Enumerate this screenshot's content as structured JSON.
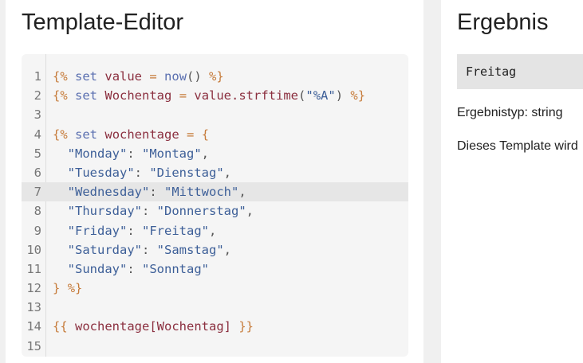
{
  "editor": {
    "title": "Template-Editor",
    "lines": [
      {
        "num": "1",
        "tokens": [
          {
            "t": "{%",
            "c": "delim"
          },
          {
            "t": " "
          },
          {
            "t": "set",
            "c": "kw"
          },
          {
            "t": " "
          },
          {
            "t": "value",
            "c": "var"
          },
          {
            "t": " = ",
            "c": "delim"
          },
          {
            "t": "now",
            "c": "kw"
          },
          {
            "t": "()",
            "c": "punc"
          },
          {
            "t": " "
          },
          {
            "t": "%}",
            "c": "delim"
          }
        ]
      },
      {
        "num": "2",
        "tokens": [
          {
            "t": "{%",
            "c": "delim"
          },
          {
            "t": " "
          },
          {
            "t": "set",
            "c": "kw"
          },
          {
            "t": " "
          },
          {
            "t": "Wochentag",
            "c": "var"
          },
          {
            "t": " = ",
            "c": "delim"
          },
          {
            "t": "value.strftime",
            "c": "var"
          },
          {
            "t": "(",
            "c": "punc"
          },
          {
            "t": "\"%A\"",
            "c": "str"
          },
          {
            "t": ")",
            "c": "punc"
          },
          {
            "t": " "
          },
          {
            "t": "%}",
            "c": "delim"
          }
        ]
      },
      {
        "num": "3",
        "tokens": []
      },
      {
        "num": "4",
        "tokens": [
          {
            "t": "{%",
            "c": "delim"
          },
          {
            "t": " "
          },
          {
            "t": "set",
            "c": "kw"
          },
          {
            "t": " "
          },
          {
            "t": "wochentage",
            "c": "var"
          },
          {
            "t": " = ",
            "c": "delim"
          },
          {
            "t": "{",
            "c": "delim"
          }
        ]
      },
      {
        "num": "5",
        "tokens": [
          {
            "t": "  "
          },
          {
            "t": "\"Monday\"",
            "c": "str"
          },
          {
            "t": ": ",
            "c": "punc"
          },
          {
            "t": "\"Montag\"",
            "c": "str"
          },
          {
            "t": ",",
            "c": "punc"
          }
        ]
      },
      {
        "num": "6",
        "tokens": [
          {
            "t": "  "
          },
          {
            "t": "\"Tuesday\"",
            "c": "str"
          },
          {
            "t": ": ",
            "c": "punc"
          },
          {
            "t": "\"Dienstag\"",
            "c": "str"
          },
          {
            "t": ",",
            "c": "punc"
          }
        ]
      },
      {
        "num": "7",
        "tokens": [
          {
            "t": "  "
          },
          {
            "t": "\"Wednesday\"",
            "c": "str"
          },
          {
            "t": ": ",
            "c": "punc"
          },
          {
            "t": "\"Mittwoch\"",
            "c": "str"
          },
          {
            "t": ",",
            "c": "punc"
          }
        ],
        "active": true
      },
      {
        "num": "8",
        "tokens": [
          {
            "t": "  "
          },
          {
            "t": "\"Thursday\"",
            "c": "str"
          },
          {
            "t": ": ",
            "c": "punc"
          },
          {
            "t": "\"Donnerstag\"",
            "c": "str"
          },
          {
            "t": ",",
            "c": "punc"
          }
        ]
      },
      {
        "num": "9",
        "tokens": [
          {
            "t": "  "
          },
          {
            "t": "\"Friday\"",
            "c": "str"
          },
          {
            "t": ": ",
            "c": "punc"
          },
          {
            "t": "\"Freitag\"",
            "c": "str"
          },
          {
            "t": ",",
            "c": "punc"
          }
        ]
      },
      {
        "num": "10",
        "tokens": [
          {
            "t": "  "
          },
          {
            "t": "\"Saturday\"",
            "c": "str"
          },
          {
            "t": ": ",
            "c": "punc"
          },
          {
            "t": "\"Samstag\"",
            "c": "str"
          },
          {
            "t": ",",
            "c": "punc"
          }
        ]
      },
      {
        "num": "11",
        "tokens": [
          {
            "t": "  "
          },
          {
            "t": "\"Sunday\"",
            "c": "str"
          },
          {
            "t": ": ",
            "c": "punc"
          },
          {
            "t": "\"Sonntag\"",
            "c": "str"
          }
        ]
      },
      {
        "num": "12",
        "tokens": [
          {
            "t": "}",
            "c": "delim"
          },
          {
            "t": " "
          },
          {
            "t": "%}",
            "c": "delim"
          }
        ]
      },
      {
        "num": "13",
        "tokens": []
      },
      {
        "num": "14",
        "tokens": [
          {
            "t": "{{",
            "c": "delim"
          },
          {
            "t": " "
          },
          {
            "t": "wochentage[Wochentag]",
            "c": "var"
          },
          {
            "t": " "
          },
          {
            "t": "}}",
            "c": "delim"
          }
        ]
      },
      {
        "num": "15",
        "tokens": []
      }
    ]
  },
  "result": {
    "title": "Ergebnis",
    "value": "Freitag",
    "type_text": "Ergebnistyp: string",
    "note": "Dieses Template wird"
  }
}
